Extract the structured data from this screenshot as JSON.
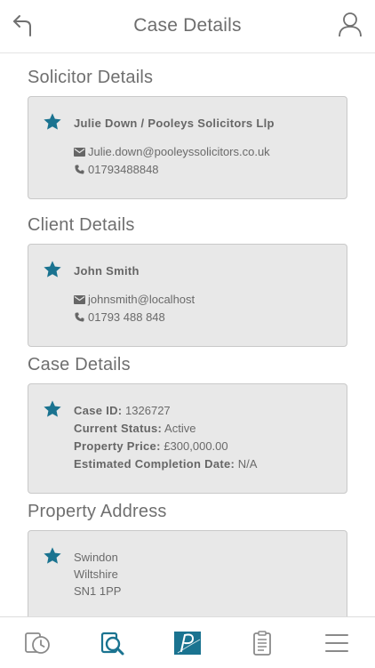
{
  "header": {
    "title": "Case Details",
    "back_icon": "back-arrow-icon",
    "user_icon": "user-profile-icon"
  },
  "colors": {
    "accent": "#1a7390",
    "card_bg": "#e8e8e8",
    "card_border": "#c9c9c9",
    "text": "#6f6f6f"
  },
  "solicitor": {
    "section_title": "Solicitor Details",
    "name": "Julie Down / Pooleys Solicitors Llp",
    "email": "Julie.down@pooleyssolicitors.co.uk",
    "phone": "01793488848"
  },
  "client": {
    "section_title": "Client Details",
    "name": "John Smith",
    "email": "johnsmith@localhost",
    "phone": "01793 488 848"
  },
  "case": {
    "section_title": "Case Details",
    "id_label": "Case ID:",
    "id_value": "1326727",
    "status_label": "Current Status:",
    "status_value": "Active",
    "price_label": "Property Price:",
    "price_value": "£300,000.00",
    "completion_label": "Estimated Completion Date:",
    "completion_value": "N/A"
  },
  "property": {
    "section_title": "Property Address",
    "line1": "Swindon",
    "line2": "Wiltshire",
    "line3": "SN1 1PP"
  },
  "tabs": [
    {
      "icon": "history-icon",
      "active": false
    },
    {
      "icon": "case-search-icon",
      "active": true
    },
    {
      "icon": "pooleys-logo-icon",
      "active": false
    },
    {
      "icon": "notes-icon",
      "active": false
    },
    {
      "icon": "menu-icon",
      "active": false
    }
  ]
}
